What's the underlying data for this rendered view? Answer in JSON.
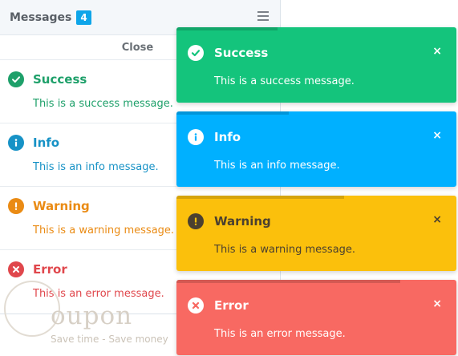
{
  "panel": {
    "title": "Messages",
    "count": "4",
    "close_label": "Close",
    "items": [
      {
        "title": "Success",
        "body": "This is a success message.",
        "color": "#1ea06a",
        "icon": "check-circle-icon"
      },
      {
        "title": "Info",
        "body": "This is an info message.",
        "color": "#1792c6",
        "icon": "info-circle-icon"
      },
      {
        "title": "Warning",
        "body": "This is a warning message.",
        "color": "#ea8b14",
        "icon": "exclamation-circle-icon"
      },
      {
        "title": "Error",
        "body": "This is an error message.",
        "color": "#e0474c",
        "icon": "times-circle-icon"
      }
    ]
  },
  "toasts": [
    {
      "title": "Success",
      "body": "This is a success message.",
      "bg": "#14c47c",
      "fg": "#ffffff",
      "icon": "check-circle-icon",
      "close": "×"
    },
    {
      "title": "Info",
      "body": "This is an info message.",
      "bg": "#00b0ff",
      "fg": "#ffffff",
      "icon": "info-circle-icon",
      "close": "×"
    },
    {
      "title": "Warning",
      "body": "This is a warning message.",
      "bg": "#fbc00c",
      "fg": "#4b4030",
      "icon": "exclamation-circle-icon",
      "close": "×"
    },
    {
      "title": "Error",
      "body": "This is an error message.",
      "bg": "#f86962",
      "fg": "#ffffff",
      "icon": "times-circle-icon",
      "close": "×"
    }
  ],
  "watermark": {
    "brand": "oupon",
    "tagline": "Save time - Save money"
  }
}
